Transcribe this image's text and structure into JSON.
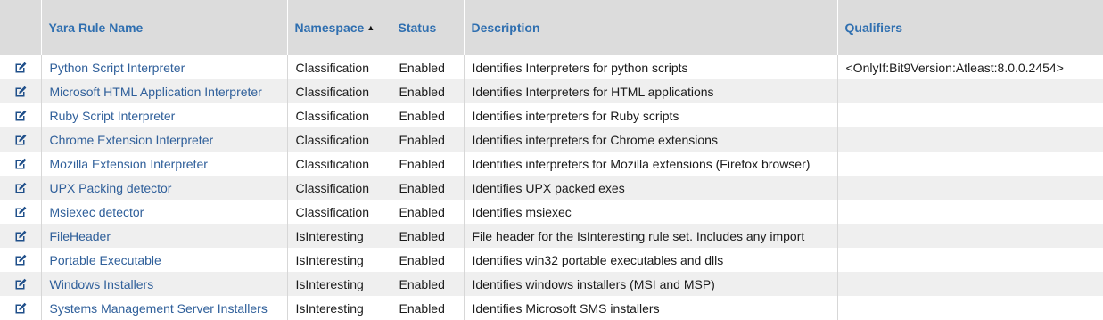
{
  "columns": {
    "name": "Yara Rule Name",
    "namespace": "Namespace",
    "status": "Status",
    "description": "Description",
    "qualifiers": "Qualifiers"
  },
  "sort": {
    "column": "namespace",
    "direction": "ascending",
    "icon": "sort-up-icon"
  },
  "colors": {
    "header_bg": "#dcdcdc",
    "header_text": "#2f6fb0",
    "link": "#2f5f9a",
    "icon": "#1f4f8a",
    "alt_row": "#efefef"
  },
  "rows": [
    {
      "name": "Python Script Interpreter",
      "namespace": "Classification",
      "status": "Enabled",
      "description": "Identifies Interpreters for python scripts",
      "qualifiers": "<OnlyIf:Bit9Version:Atleast:8.0.0.2454>"
    },
    {
      "name": "Microsoft HTML Application Interpreter",
      "namespace": "Classification",
      "status": "Enabled",
      "description": "Identifies Interpreters for HTML applications",
      "qualifiers": ""
    },
    {
      "name": "Ruby Script Interpreter",
      "namespace": "Classification",
      "status": "Enabled",
      "description": "Identifies interpreters for Ruby scripts",
      "qualifiers": ""
    },
    {
      "name": "Chrome Extension Interpreter",
      "namespace": "Classification",
      "status": "Enabled",
      "description": "Identifies interpreters for Chrome extensions",
      "qualifiers": ""
    },
    {
      "name": "Mozilla Extension Interpreter",
      "namespace": "Classification",
      "status": "Enabled",
      "description": "Identifies interpreters for Mozilla extensions (Firefox browser)",
      "qualifiers": ""
    },
    {
      "name": "UPX Packing detector",
      "namespace": "Classification",
      "status": "Enabled",
      "description": "Identifies UPX packed exes",
      "qualifiers": ""
    },
    {
      "name": "Msiexec detector",
      "namespace": "Classification",
      "status": "Enabled",
      "description": "Identifies msiexec",
      "qualifiers": ""
    },
    {
      "name": "FileHeader",
      "namespace": "IsInteresting",
      "status": "Enabled",
      "description": "File header for the IsInteresting rule set. Includes any import",
      "qualifiers": ""
    },
    {
      "name": "Portable Executable",
      "namespace": "IsInteresting",
      "status": "Enabled",
      "description": "Identifies win32 portable executables and dlls",
      "qualifiers": ""
    },
    {
      "name": "Windows Installers",
      "namespace": "IsInteresting",
      "status": "Enabled",
      "description": "Identifies windows installers (MSI and MSP)",
      "qualifiers": ""
    },
    {
      "name": "Systems Management Server Installers",
      "namespace": "IsInteresting",
      "status": "Enabled",
      "description": "Identifies Microsoft SMS installers",
      "qualifiers": ""
    }
  ]
}
